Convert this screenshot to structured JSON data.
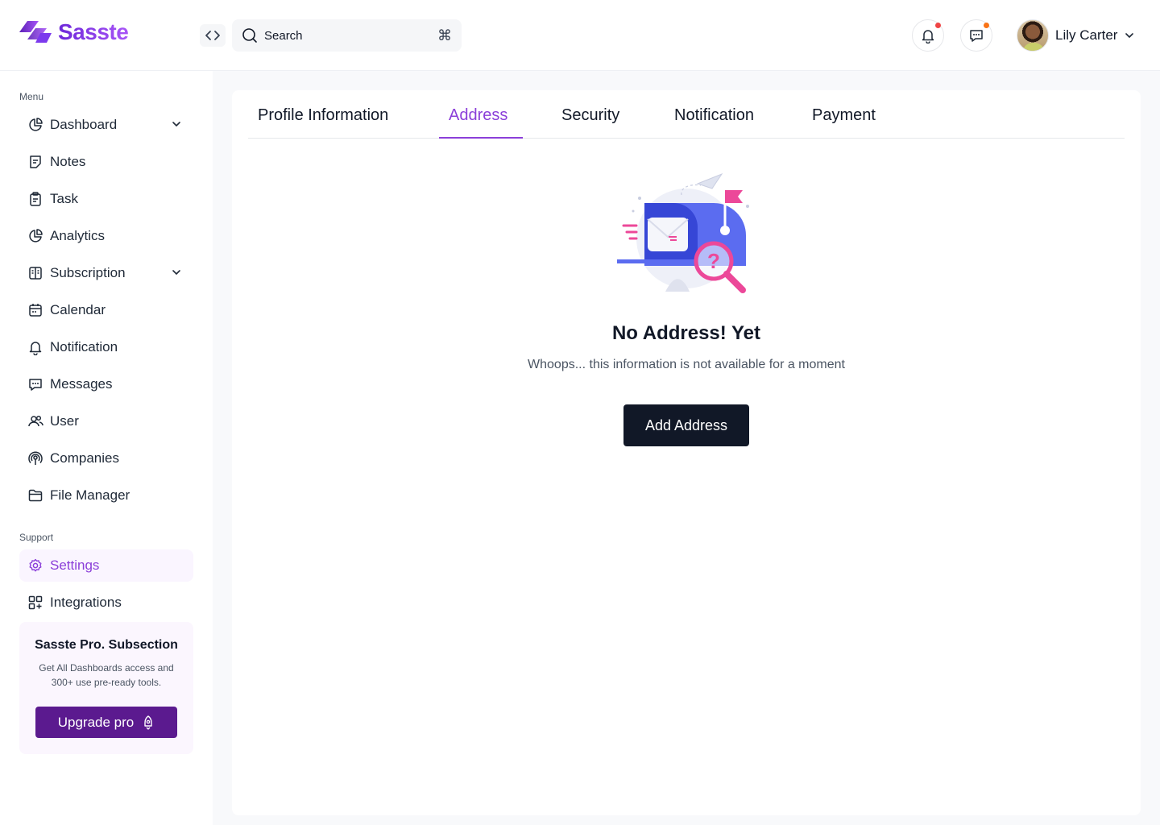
{
  "brand": {
    "name": "Sasste",
    "accent": "#8b3fd9"
  },
  "header": {
    "search_placeholder": "Search",
    "search_shortcut_icon": "command-icon",
    "notification_dot_color": "#ef4444",
    "message_dot_color": "#f97316",
    "user_name": "Lily Carter"
  },
  "sidebar": {
    "menu_label": "Menu",
    "support_label": "Support",
    "items": [
      {
        "label": "Dashboard",
        "icon": "pie-chart-icon",
        "has_chevron": true
      },
      {
        "label": "Notes",
        "icon": "note-icon"
      },
      {
        "label": "Task",
        "icon": "clipboard-icon"
      },
      {
        "label": "Analytics",
        "icon": "pie-chart-icon"
      },
      {
        "label": "Subscription",
        "icon": "layout-icon",
        "has_chevron": true
      },
      {
        "label": "Calendar",
        "icon": "calendar-icon"
      },
      {
        "label": "Notification",
        "icon": "bell-icon"
      },
      {
        "label": "Messages",
        "icon": "chat-icon"
      },
      {
        "label": "User",
        "icon": "users-icon"
      },
      {
        "label": "Companies",
        "icon": "broadcast-icon"
      },
      {
        "label": "File Manager",
        "icon": "folder-icon"
      }
    ],
    "support_items": [
      {
        "label": "Settings",
        "icon": "gear-icon",
        "active": true
      },
      {
        "label": "Integrations",
        "icon": "apps-icon"
      }
    ],
    "promo": {
      "title": "Sasste Pro. Subsection",
      "text": "Get All Dashboards access and 300+ use pre-ready tools.",
      "button_label": "Upgrade pro"
    }
  },
  "main": {
    "tabs": [
      {
        "label": "Profile Information"
      },
      {
        "label": "Address",
        "active": true
      },
      {
        "label": "Security"
      },
      {
        "label": "Notification"
      },
      {
        "label": "Payment"
      }
    ],
    "empty_state": {
      "illustration": "mailbox-search-illustration",
      "title": "No Address! Yet",
      "subtitle": "Whoops... this information is not available for a moment",
      "button_label": "Add Address"
    }
  }
}
